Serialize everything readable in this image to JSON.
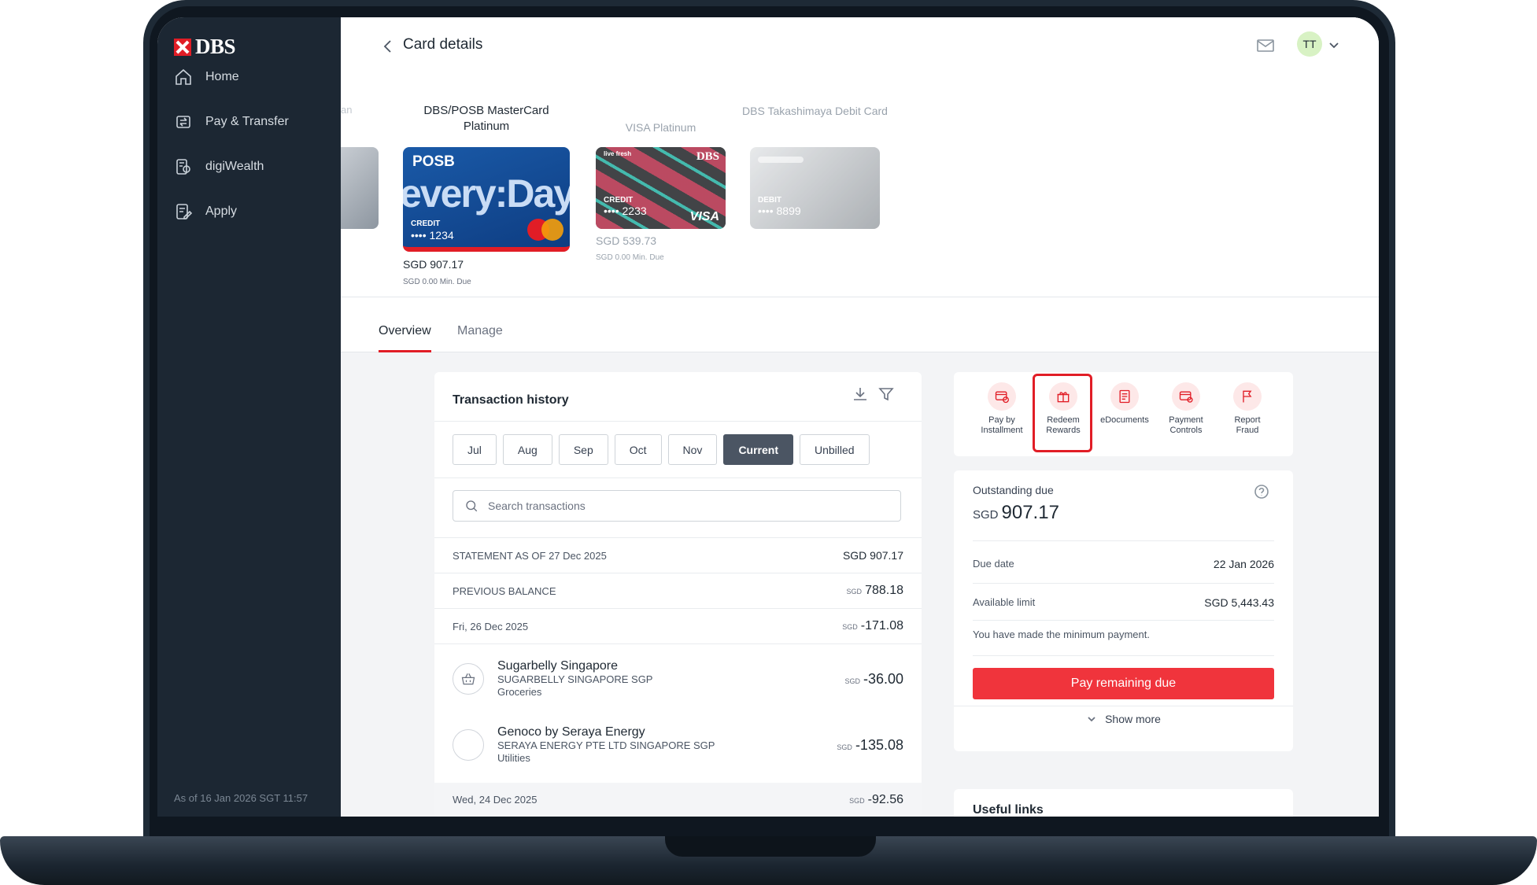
{
  "sidebar": {
    "logo": "DBS",
    "items": [
      {
        "label": "Home",
        "icon": "home-icon"
      },
      {
        "label": "Pay & Transfer",
        "icon": "transfer-icon"
      },
      {
        "label": "digiWealth",
        "icon": "wealth-icon"
      },
      {
        "label": "Apply",
        "icon": "apply-icon"
      }
    ],
    "as_of": "As of 16 Jan 2026 SGT 11:57"
  },
  "header": {
    "title": "Card details",
    "avatar_initials": "TT"
  },
  "cards": {
    "peek_label": "an",
    "items": [
      {
        "name": "DBS/POSB MasterCard Platinum",
        "brand": "POSB",
        "art_text": "every:Day",
        "type": "CREDIT",
        "number": "•••• 1234",
        "balance": "SGD 907.17",
        "min_due": "SGD 0.00 Min. Due"
      },
      {
        "name": "VISA Platinum",
        "brand": "DBS",
        "art_text": "live fresh",
        "type": "CREDIT",
        "number": "•••• 2233",
        "network": "VISA",
        "balance": "SGD 539.73",
        "min_due": "SGD 0.00 Min. Due"
      },
      {
        "name": "DBS Takashimaya Debit Card",
        "type": "DEBIT",
        "number": "•••• 8899"
      }
    ]
  },
  "tabs": [
    {
      "label": "Overview",
      "active": true
    },
    {
      "label": "Manage",
      "active": false
    }
  ],
  "transactions": {
    "title": "Transaction history",
    "months": [
      "Jul",
      "Aug",
      "Sep",
      "Oct",
      "Nov",
      "Current",
      "Unbilled"
    ],
    "active_month": "Current",
    "search_placeholder": "Search transactions",
    "statement_label": "STATEMENT AS OF 27 Dec 2025",
    "statement_amount": "SGD 907.17",
    "previous_balance_label": "PREVIOUS BALANCE",
    "previous_balance_currency": "SGD",
    "previous_balance_amount": "788.18",
    "groups": [
      {
        "date": "Fri, 26 Dec 2025",
        "currency": "SGD",
        "total": "-171.08"
      },
      {
        "date": "Wed, 24 Dec 2025",
        "currency": "SGD",
        "total": "-92.56"
      }
    ],
    "items": [
      {
        "merchant": "Sugarbelly Singapore",
        "descriptor": "SUGARBELLY SINGAPORE SGP",
        "category": "Groceries",
        "currency": "SGD",
        "amount": "-36.00",
        "icon": "basket-icon"
      },
      {
        "merchant": "Genoco by Seraya Energy",
        "descriptor": "SERAYA ENERGY PTE LTD SINGAPORE SGP",
        "category": "Utilities",
        "currency": "SGD",
        "amount": "-135.08",
        "icon": "utilities-icon"
      }
    ]
  },
  "actions": [
    {
      "label_1": "Pay by",
      "label_2": "Installment",
      "icon": "installment-icon"
    },
    {
      "label_1": "Redeem",
      "label_2": "Rewards",
      "icon": "gift-icon"
    },
    {
      "label_1": "eDocuments",
      "label_2": "",
      "icon": "document-icon"
    },
    {
      "label_1": "Payment",
      "label_2": "Controls",
      "icon": "card-settings-icon"
    },
    {
      "label_1": "Report",
      "label_2": "Fraud",
      "icon": "flag-icon"
    }
  ],
  "outstanding": {
    "label": "Outstanding due",
    "currency": "SGD",
    "amount": "907.17",
    "due_date_label": "Due date",
    "due_date": "22 Jan 2026",
    "available_limit_label": "Available limit",
    "available_limit": "SGD 5,443.43",
    "note": "You have made the minimum payment.",
    "pay_button": "Pay remaining due",
    "show_more": "Show more"
  },
  "useful_links": {
    "title": "Useful links"
  },
  "help_fab": "?",
  "colors": {
    "accent": "#e11d26",
    "sidebar": "#1c2733",
    "active_month": "#4b5563"
  }
}
